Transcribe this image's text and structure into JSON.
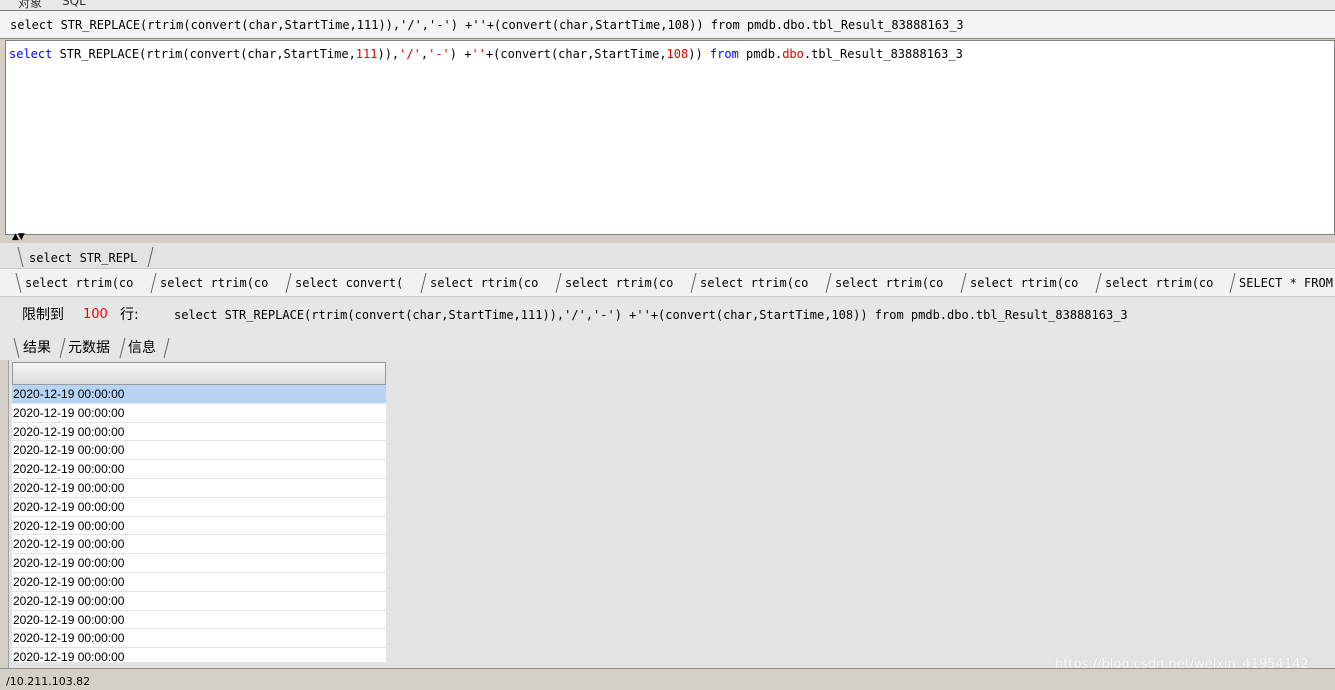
{
  "top_tabs": [
    "对象",
    "SQL"
  ],
  "sql_bar": {
    "text": "select STR_REPLACE(rtrim(convert(char,StartTime,111)),'/','-') +''+(convert(char,StartTime,108)) from pmdb.dbo.tbl_Result_83888163_3"
  },
  "editor": {
    "tokens": [
      {
        "t": "select",
        "c": "kw"
      },
      {
        "t": " STR_REPLACE(rtrim(convert(char,StartTime,",
        "c": "plain"
      },
      {
        "t": "111",
        "c": "num"
      },
      {
        "t": ")),",
        "c": "plain"
      },
      {
        "t": "'/'",
        "c": "str"
      },
      {
        "t": ",",
        "c": "plain"
      },
      {
        "t": "'-'",
        "c": "str"
      },
      {
        "t": ") +",
        "c": "plain"
      },
      {
        "t": "''",
        "c": "str"
      },
      {
        "t": "+(convert(char,StartTime,",
        "c": "plain"
      },
      {
        "t": "108",
        "c": "num"
      },
      {
        "t": ")) ",
        "c": "plain"
      },
      {
        "t": "from",
        "c": "kw"
      },
      {
        "t": " pmdb.",
        "c": "plain"
      },
      {
        "t": "dbo",
        "c": "str"
      },
      {
        "t": ".tbl_Result_83888163_3",
        "c": "plain"
      }
    ]
  },
  "query_tabs_row1": [
    "select STR_REPL"
  ],
  "query_tabs_row2": [
    "select rtrim(co",
    "select rtrim(co",
    "select convert(",
    "select rtrim(co",
    "select rtrim(co",
    "select rtrim(co",
    "select rtrim(co",
    "select rtrim(co",
    "select rtrim(co",
    "SELECT * FROM"
  ],
  "limit_bar": {
    "prefix": "限制到",
    "value": "100",
    "suffix": "行:",
    "sql": "select STR_REPLACE(rtrim(convert(char,StartTime,111)),'/','-') +''+(convert(char,StartTime,108)) from pmdb.dbo.tbl_Result_83888163_3"
  },
  "result_tabs": [
    "结果",
    "元数据",
    "信息"
  ],
  "grid": {
    "header": "",
    "rows": [
      "2020-12-19 00:00:00",
      "2020-12-19 00:00:00",
      "2020-12-19 00:00:00",
      "2020-12-19 00:00:00",
      "2020-12-19 00:00:00",
      "2020-12-19 00:00:00",
      "2020-12-19 00:00:00",
      "2020-12-19 00:00:00",
      "2020-12-19 00:00:00",
      "2020-12-19 00:00:00",
      "2020-12-19 00:00:00",
      "2020-12-19 00:00:00",
      "2020-12-19 00:00:00",
      "2020-12-19 00:00:00",
      "2020-12-19 00:00:00"
    ],
    "selected_index": 0
  },
  "status_bar": {
    "ip": "/10.211.103.82"
  },
  "watermark": "https://blog.csdn.net/weixin_41954142",
  "colors": {
    "keyword": "#0000ff",
    "literal": "#dd0000",
    "selection": "#b7d4f4",
    "limit_value": "#ff0000"
  }
}
